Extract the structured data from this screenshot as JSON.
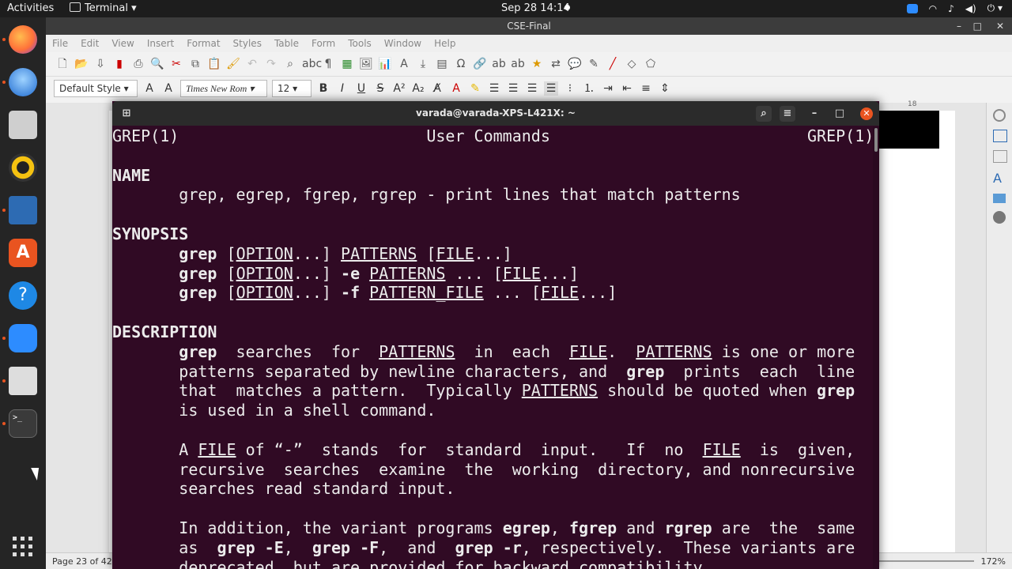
{
  "topbar": {
    "activities": "Activities",
    "app": "Terminal",
    "datetime": "Sep 28  14:14"
  },
  "writer": {
    "title": "CSE-Final",
    "menu": [
      "File",
      "Edit",
      "View",
      "Insert",
      "Format",
      "Styles",
      "Table",
      "Form",
      "Tools",
      "Window",
      "Help"
    ],
    "paragraph_style": "Default Style",
    "font_name": "Times New Rom",
    "font_size": "12",
    "status_page": "Page 23 of 42",
    "zoom": "172%",
    "ruler_mark": "18"
  },
  "terminal": {
    "title": "varada@varada-XPS-L421X: ~",
    "lines": [
      [
        {
          "t": "GREP(1)                          User Commands                           GREP(1)"
        }
      ],
      [
        {
          "t": ""
        }
      ],
      [
        {
          "t": "NAME",
          "s": "b"
        }
      ],
      [
        {
          "t": "       grep, egrep, fgrep, rgrep - print lines that match patterns"
        }
      ],
      [
        {
          "t": ""
        }
      ],
      [
        {
          "t": "SYNOPSIS",
          "s": "b"
        }
      ],
      [
        {
          "t": "       "
        },
        {
          "t": "grep",
          "s": "b"
        },
        {
          "t": " ["
        },
        {
          "t": "OPTION",
          "s": "u"
        },
        {
          "t": "...] "
        },
        {
          "t": "PATTERNS",
          "s": "u"
        },
        {
          "t": " ["
        },
        {
          "t": "FILE",
          "s": "u"
        },
        {
          "t": "...]"
        }
      ],
      [
        {
          "t": "       "
        },
        {
          "t": "grep",
          "s": "b"
        },
        {
          "t": " ["
        },
        {
          "t": "OPTION",
          "s": "u"
        },
        {
          "t": "...] "
        },
        {
          "t": "-e",
          "s": "b"
        },
        {
          "t": " "
        },
        {
          "t": "PATTERNS",
          "s": "u"
        },
        {
          "t": " ... ["
        },
        {
          "t": "FILE",
          "s": "u"
        },
        {
          "t": "...]"
        }
      ],
      [
        {
          "t": "       "
        },
        {
          "t": "grep",
          "s": "b"
        },
        {
          "t": " ["
        },
        {
          "t": "OPTION",
          "s": "u"
        },
        {
          "t": "...] "
        },
        {
          "t": "-f",
          "s": "b"
        },
        {
          "t": " "
        },
        {
          "t": "PATTERN_FILE",
          "s": "u"
        },
        {
          "t": " ... ["
        },
        {
          "t": "FILE",
          "s": "u"
        },
        {
          "t": "...]"
        }
      ],
      [
        {
          "t": ""
        }
      ],
      [
        {
          "t": "DESCRIPTION",
          "s": "b"
        }
      ],
      [
        {
          "t": "       "
        },
        {
          "t": "grep",
          "s": "b"
        },
        {
          "t": "  searches  for  "
        },
        {
          "t": "PATTERNS",
          "s": "u"
        },
        {
          "t": "  in  each  "
        },
        {
          "t": "FILE",
          "s": "u"
        },
        {
          "t": ".  "
        },
        {
          "t": "PATTERNS",
          "s": "u"
        },
        {
          "t": " is one or more"
        }
      ],
      [
        {
          "t": "       patterns separated by newline characters, and  "
        },
        {
          "t": "grep",
          "s": "b"
        },
        {
          "t": "  prints  each  line"
        }
      ],
      [
        {
          "t": "       that  matches a pattern.  Typically "
        },
        {
          "t": "PATTERNS",
          "s": "u"
        },
        {
          "t": " should be quoted when "
        },
        {
          "t": "grep",
          "s": "b"
        }
      ],
      [
        {
          "t": "       is used in a shell command."
        }
      ],
      [
        {
          "t": ""
        }
      ],
      [
        {
          "t": "       A "
        },
        {
          "t": "FILE",
          "s": "u"
        },
        {
          "t": " of “-”  stands  for  standard  input.   If  no  "
        },
        {
          "t": "FILE",
          "s": "u"
        },
        {
          "t": "  is  given,"
        }
      ],
      [
        {
          "t": "       recursive  searches  examine  the  working  directory, and nonrecursive"
        }
      ],
      [
        {
          "t": "       searches read standard input."
        }
      ],
      [
        {
          "t": ""
        }
      ],
      [
        {
          "t": "       In addition, the variant programs "
        },
        {
          "t": "egrep",
          "s": "b"
        },
        {
          "t": ", "
        },
        {
          "t": "fgrep",
          "s": "b"
        },
        {
          "t": " and "
        },
        {
          "t": "rgrep",
          "s": "b"
        },
        {
          "t": " are  the  same"
        }
      ],
      [
        {
          "t": "       as  "
        },
        {
          "t": "grep -E",
          "s": "b"
        },
        {
          "t": ",  "
        },
        {
          "t": "grep -F",
          "s": "b"
        },
        {
          "t": ",  and  "
        },
        {
          "t": "grep -r",
          "s": "b"
        },
        {
          "t": ", respectively.  These variants are"
        }
      ],
      [
        {
          "t": "       deprecated, but are provided for backward compatibility."
        }
      ]
    ]
  }
}
